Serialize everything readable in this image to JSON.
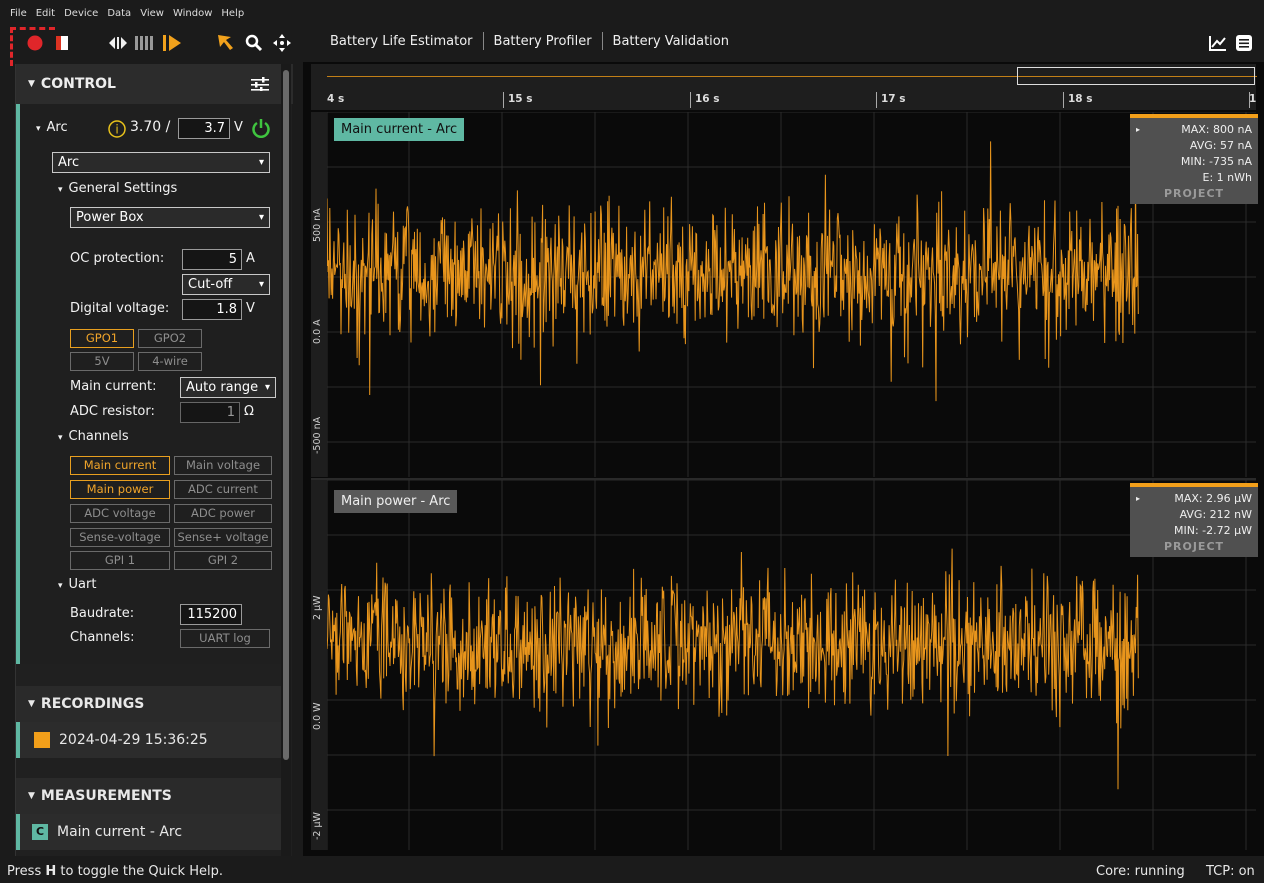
{
  "menu": [
    "File",
    "Edit",
    "Device",
    "Data",
    "View",
    "Window",
    "Help"
  ],
  "tabs": [
    "Battery Life Estimator",
    "Battery Profiler",
    "Battery Validation"
  ],
  "colors": {
    "accent": "#f29f1a",
    "teal": "#5fb8a3",
    "record": "#e0262a",
    "power_on": "#3fc43f"
  },
  "control": {
    "title": "CONTROL",
    "device_label": "Arc",
    "voltage_read": "3.70 /",
    "voltage_set": "3.7",
    "voltage_unit": "V",
    "device_select": "Arc",
    "general_settings": "General Settings",
    "mode_select": "Power Box",
    "oc_label": "OC protection:",
    "oc_value": "5",
    "oc_unit": "A",
    "oc_mode": "Cut-off",
    "digital_label": "Digital voltage:",
    "digital_value": "1.8",
    "digital_unit": "V",
    "gpo": [
      "GPO1",
      "GPO2",
      "5V",
      "4-wire"
    ],
    "main_current_label": "Main current:",
    "main_current_value": "Auto range",
    "adc_label": "ADC resistor:",
    "adc_value": "1",
    "adc_unit": "Ω",
    "channels_title": "Channels",
    "channels": [
      "Main current",
      "Main voltage",
      "Main power",
      "ADC current",
      "ADC voltage",
      "ADC power",
      "Sense-voltage",
      "Sense+ voltage",
      "GPI 1",
      "GPI 2"
    ],
    "uart_title": "Uart",
    "baud_label": "Baudrate:",
    "baud_value": "115200",
    "uart_channels_label": "Channels:",
    "uart_log": "UART log"
  },
  "recordings": {
    "title": "RECORDINGS",
    "item": "2024-04-29 15:36:25"
  },
  "measurements": {
    "title": "MEASUREMENTS",
    "badge": "C",
    "item": "Main current - Arc"
  },
  "time_ticks": [
    "4 s",
    "15 s",
    "16 s",
    "17 s",
    "18 s",
    "1"
  ],
  "plot1": {
    "title": "Main current - Arc",
    "y_ticks": [
      "500 nA",
      "0.0 A",
      "-500 nA"
    ],
    "stats": {
      "max": "MAX:  800 nA",
      "avg": "AVG:  57 nA",
      "min": "MIN:  -735 nA",
      "e": "E:  1 nWh",
      "project": "PROJECT"
    }
  },
  "plot2": {
    "title": "Main power - Arc",
    "y_ticks": [
      "2 µW",
      "0.0 W",
      "-2 µW"
    ],
    "stats": {
      "max": "MAX:  2.96 µW",
      "avg": "AVG:  212 nW",
      "min": "MIN:  -2.72 µW",
      "project": "PROJECT"
    }
  },
  "status": {
    "help_pre": "Press ",
    "help_key": "H",
    "help_post": " to toggle the Quick Help.",
    "core": "Core: running",
    "tcp": "TCP: on"
  }
}
